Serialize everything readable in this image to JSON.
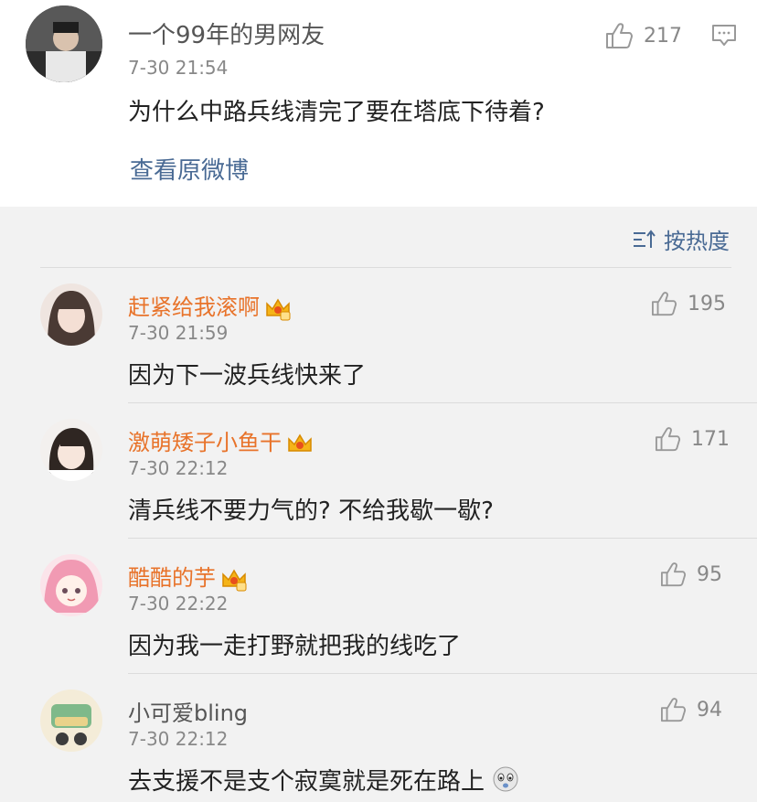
{
  "main_post": {
    "author": "一个99年的男网友",
    "time": "7-30 21:54",
    "text": "为什么中路兵线清完了要在塔底下待着?",
    "likes": "217",
    "view_original": "查看原微博"
  },
  "sort": {
    "label": "按热度"
  },
  "comments": [
    {
      "author": "赶紧给我滚啊",
      "vip": true,
      "time": "7-30 21:59",
      "text": "因为下一波兵线快来了",
      "likes": "195"
    },
    {
      "author": "激萌矮子小鱼干",
      "vip": true,
      "time": "7-30 22:12",
      "text": "清兵线不要力气的? 不给我歇一歇?",
      "likes": "171"
    },
    {
      "author": "酷酷的芋",
      "vip": true,
      "time": "7-30 22:22",
      "text": "因为我一走打野就把我的线吃了",
      "likes": "95"
    },
    {
      "author": "小可爱bling",
      "vip": false,
      "time": "7-30 22:12",
      "text": "去支援不是支个寂寞就是死在路上",
      "likes": "94",
      "emoji": "scared-dog-emoji"
    }
  ],
  "colors": {
    "orange_name": "#e8732a",
    "link_blue": "#496a94",
    "panel_bg": "#f2f2f2"
  }
}
